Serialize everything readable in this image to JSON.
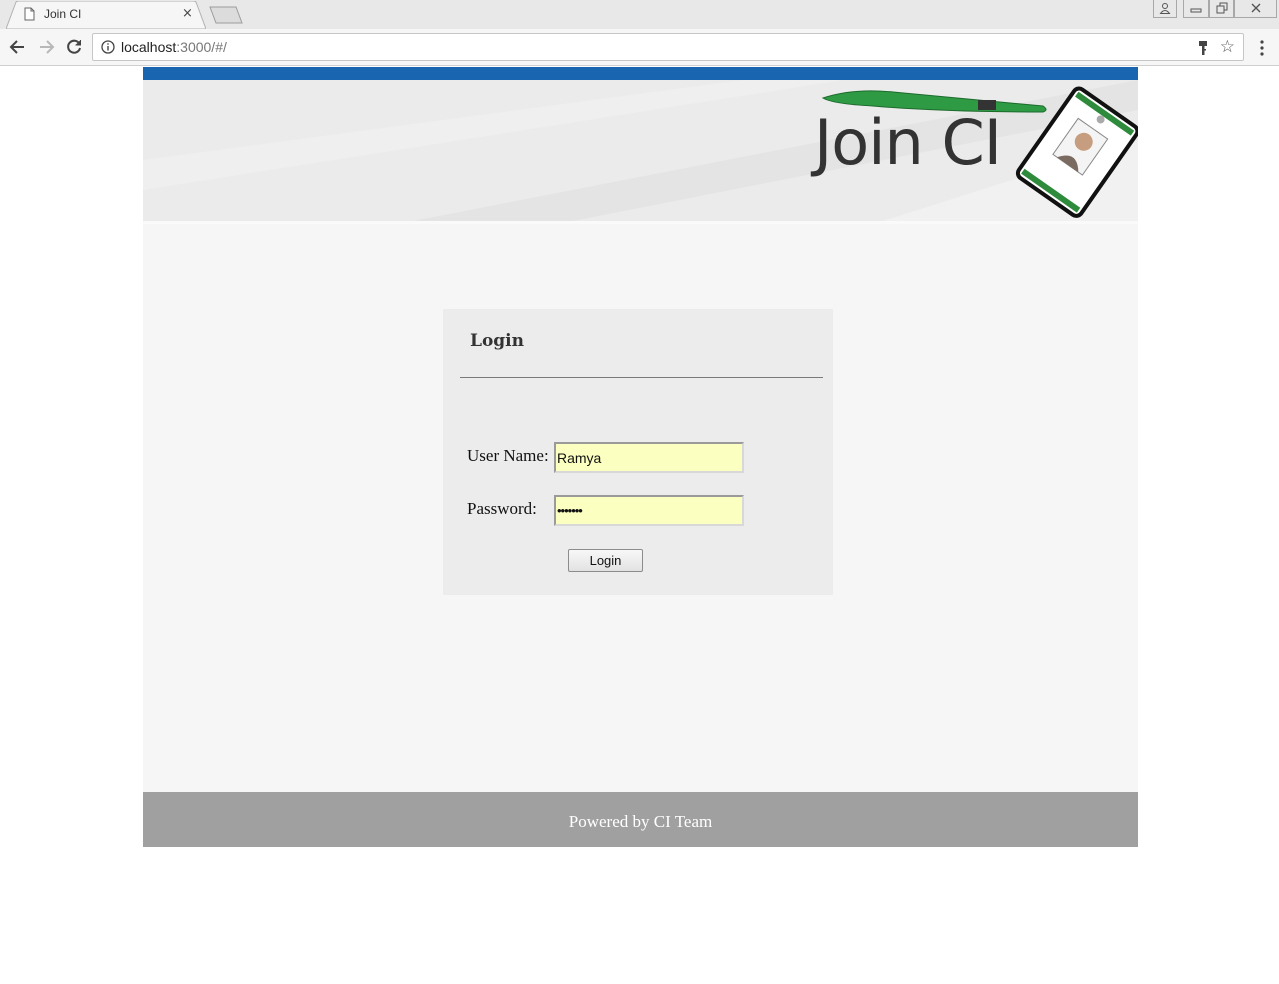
{
  "browser": {
    "tab_title": "Join CI",
    "tab_close": "×",
    "url_host": "localhost",
    "url_rest": ":3000/#/",
    "star": "☆"
  },
  "banner": {
    "logo_text": "Join CI"
  },
  "login": {
    "title": "Login",
    "username_label": "User Name:",
    "username_value": "Ramya",
    "password_label": "Password:",
    "password_value": "•••••••",
    "button_label": "Login"
  },
  "footer": {
    "text": "Powered by CI Team"
  },
  "colors": {
    "top_bar": "#1a65b0",
    "input_autofill": "#fbffc0",
    "footer_bg": "#a0a0a0"
  }
}
